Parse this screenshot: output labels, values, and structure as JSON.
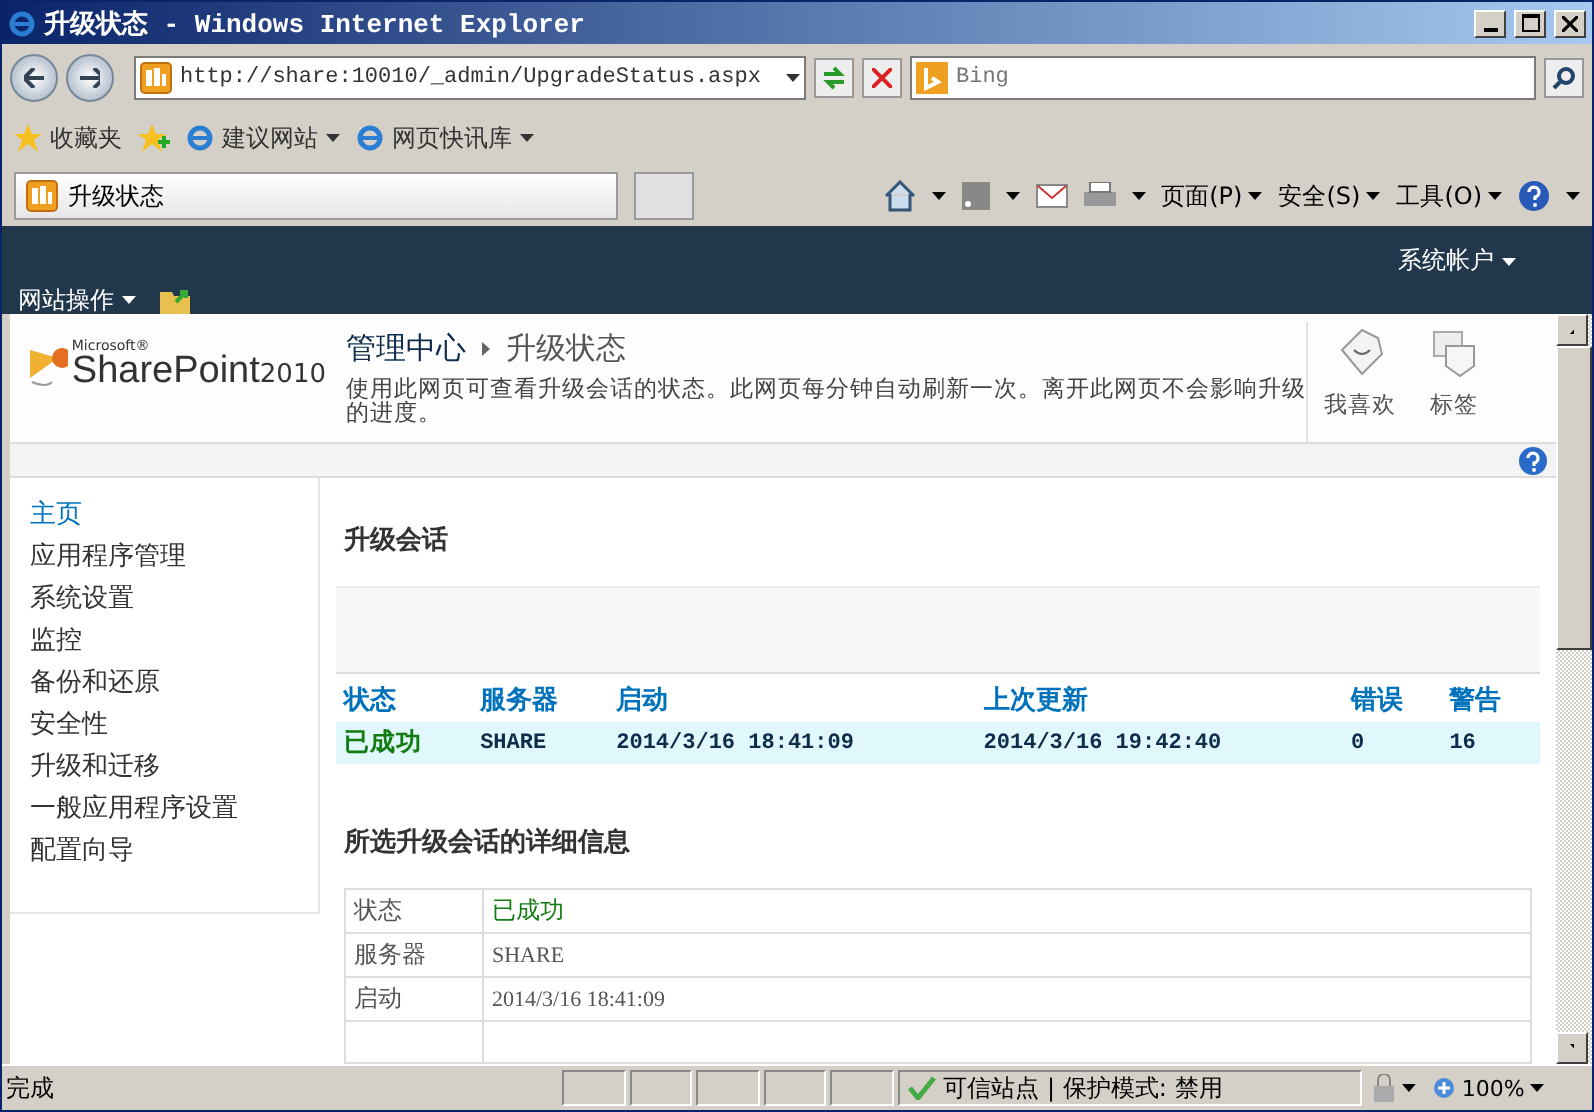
{
  "window": {
    "title": "升级状态 - Windows Internet Explorer"
  },
  "address_bar": {
    "url": "http://share:10010/_admin/UpgradeStatus.aspx",
    "search_placeholder": "Bing"
  },
  "favorites_bar": {
    "label": "收藏夹",
    "items": [
      {
        "label": "建议网站"
      },
      {
        "label": "网页快讯库"
      }
    ]
  },
  "tabs": [
    {
      "label": "升级状态",
      "selected": true
    }
  ],
  "command_bar": {
    "items": [
      {
        "label": "页面(P)"
      },
      {
        "label": "安全(S)"
      },
      {
        "label": "工具(O)"
      }
    ]
  },
  "ribbon": {
    "site_actions": "网站操作",
    "user": "系统帐户"
  },
  "header": {
    "logo_brand": "Microsoft®",
    "logo_name": "SharePoint",
    "logo_version": "2010",
    "breadcrumb": [
      "管理中心",
      "升级状态"
    ],
    "description": "使用此网页可查看升级会话的状态。此网页每分钟自动刷新一次。离开此网页不会影响升级的进度。",
    "actions": [
      {
        "label": "我喜欢"
      },
      {
        "label": "标签"
      }
    ]
  },
  "sidebar": {
    "items": [
      {
        "label": "主页",
        "selected": true
      },
      {
        "label": "应用程序管理",
        "selected": false
      },
      {
        "label": "系统设置",
        "selected": false
      },
      {
        "label": "监控",
        "selected": false
      },
      {
        "label": "备份和还原",
        "selected": false
      },
      {
        "label": "安全性",
        "selected": false
      },
      {
        "label": "升级和迁移",
        "selected": false
      },
      {
        "label": "一般应用程序设置",
        "selected": false
      },
      {
        "label": "配置向导",
        "selected": false
      }
    ]
  },
  "sessions": {
    "title": "升级会话",
    "columns": [
      "状态",
      "服务器",
      "启动",
      "上次更新",
      "错误",
      "警告"
    ],
    "rows": [
      {
        "cells": [
          "已成功",
          "SHARE",
          "2014/3/16 18:41:09",
          "2014/3/16 19:42:40",
          "0",
          "16"
        ],
        "selected": true
      }
    ]
  },
  "details": {
    "title": "所选升级会话的详细信息",
    "rows": [
      {
        "label": "状态",
        "value": "已成功",
        "kind": "status"
      },
      {
        "label": "服务器",
        "value": "SHARE",
        "kind": "plain"
      },
      {
        "label": "启动",
        "value": "2014/3/16 18:41:09",
        "kind": "plain"
      }
    ]
  },
  "status_bar": {
    "text": "完成",
    "zone": "可信站点 | 保护模式: 禁用",
    "zoom": "100%"
  }
}
